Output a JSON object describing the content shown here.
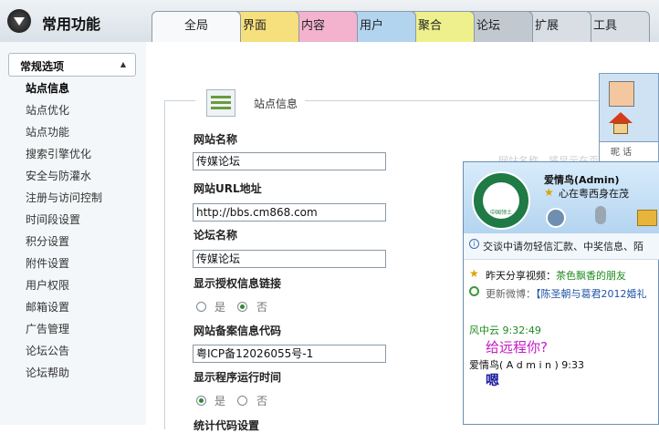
{
  "app_title": "常用功能",
  "tabs": [
    {
      "label": "全局",
      "bg": "#f7f9fb"
    },
    {
      "label": "界面",
      "bg": "#f6e07d"
    },
    {
      "label": "内容",
      "bg": "#f3b3cf"
    },
    {
      "label": "用户",
      "bg": "#b2d4ef"
    },
    {
      "label": "聚合",
      "bg": "#eef08d"
    },
    {
      "label": "论坛",
      "bg": "#c1c8cf"
    },
    {
      "label": "扩展",
      "bg": "#d8dee4"
    },
    {
      "label": "工具",
      "bg": "#d8dee4"
    }
  ],
  "sidebar": {
    "header": "常规选项",
    "items": [
      "站点信息",
      "站点优化",
      "站点功能",
      "搜索引擎优化",
      "安全与防灌水",
      "注册与访问控制",
      "时间段设置",
      "积分设置",
      "附件设置",
      "用户权限",
      "邮箱设置",
      "广告管理",
      "论坛公告",
      "论坛帮助"
    ]
  },
  "section": {
    "title": "站点信息"
  },
  "form": {
    "site_name_label": "网站名称",
    "site_name_value": "传媒论坛",
    "site_url_label": "网站URL地址",
    "site_url_value": "http://bbs.cm868.com",
    "forum_name_label": "论坛名称",
    "forum_name_value": "传媒论坛",
    "show_license_label": "显示授权信息链接",
    "icp_label": "网站备案信息代码",
    "icp_value": "粤ICP备12026055号-1",
    "show_runtime_label": "显示程序运行时间",
    "stats_label": "统计代码设置",
    "yes": "是",
    "no": "否",
    "hint_text": "网站名称，将显示在页"
  },
  "chat": {
    "name": "爱情鸟(Admin)",
    "signature": "心在粤西身在茂",
    "notice": "交谈中请勿轻信汇款、中奖信息、陌",
    "feed1_label": "昨天分享视频：",
    "feed1_value": "茶色飘香的朋友",
    "feed2_label": "更新微博：",
    "feed2_value": "【陈圣朝与葛君2012婚礼",
    "msg1_header": "风中云  9:32:49",
    "msg1_body": "给远程你?",
    "msg2_header": "爱情鸟(  A d m i n ) 9:33",
    "msg2_body": "嗯"
  },
  "bg_window": {
    "text": "昵 话"
  }
}
